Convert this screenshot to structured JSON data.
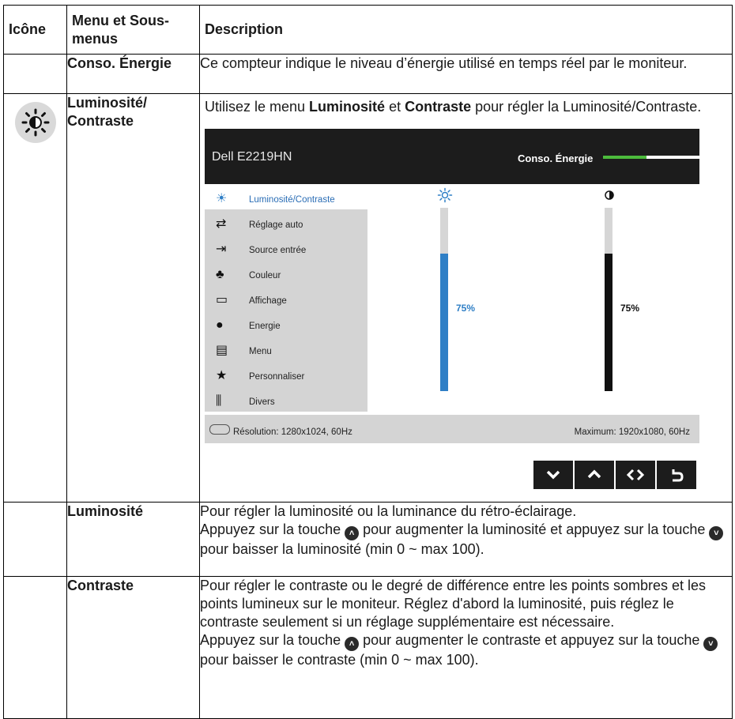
{
  "header": {
    "col_icon": "Icône",
    "col_menu": "Menu et Sous-menus",
    "col_desc": "Description"
  },
  "rows": [
    {
      "menu": "Conso. Énergie",
      "desc": "Ce compteur indique le niveau d’énergie utilisé en temps réel par le moniteur."
    },
    {
      "icon": "brightness-sun-icon",
      "menu": "Luminosité/ Contraste",
      "desc_pre": "Utilisez le menu ",
      "desc_b1": "Luminosité",
      "desc_mid": " et ",
      "desc_b2": "Contraste",
      "desc_post": " pour régler la Luminosité/Contraste."
    },
    {
      "menu": "Luminosité",
      "desc_l1": "Pour régler la luminosité ou la luminance du rétro-éclairage.",
      "desc_l2a": "Appuyez sur la touche ",
      "desc_l2b": " pour augmenter la luminosité et appuyez sur la touche ",
      "desc_l2c": " pour baisser la luminosité (min 0 ~ max 100)."
    },
    {
      "menu": "Contraste",
      "desc_l1": "Pour régler le contraste ou le degré de différence entre les points sombres et les points lumineux sur le moniteur. Réglez d'abord la luminosité, puis réglez le contraste seulement si un réglage supplémentaire est nécessaire.",
      "desc_l2a": "Appuyez sur la touche ",
      "desc_l2b": " pour augmenter le contraste et appuyez sur la touche ",
      "desc_l2c": " pour baisser le contraste (min 0 ~ max 100)."
    }
  ],
  "osd": {
    "title": "Dell E2219HN",
    "energy_label": "Conso. Énergie",
    "energy_level": 0.45,
    "menu": [
      {
        "label": "Luminosité/Contraste",
        "icon": "sun-icon",
        "active": true
      },
      {
        "label": "Réglage auto",
        "icon": "auto-adjust-icon"
      },
      {
        "label": "Source entrée",
        "icon": "input-source-icon"
      },
      {
        "label": "Couleur",
        "icon": "color-icon"
      },
      {
        "label": "Affichage",
        "icon": "display-icon"
      },
      {
        "label": "Energie",
        "icon": "energy-icon"
      },
      {
        "label": "Menu",
        "icon": "menu-icon"
      },
      {
        "label": "Personnaliser",
        "icon": "star-icon"
      },
      {
        "label": "Divers",
        "icon": "others-icon"
      }
    ],
    "brightness": {
      "value": 75,
      "label": "75%",
      "color": "#2f7fc6"
    },
    "contrast": {
      "value": 75,
      "label": "75%",
      "color": "#111111"
    },
    "resolution": "Résolution: 1280x1024, 60Hz",
    "maximum": "Maximum: 1920x1080, 60Hz",
    "buttons": [
      "chevron-down-icon",
      "chevron-up-icon",
      "enter-icon",
      "back-icon"
    ]
  },
  "colors": {
    "accent_blue": "#2f7fc6",
    "energy_green": "#4cbb3c",
    "osd_dark": "#1c1c1c"
  }
}
